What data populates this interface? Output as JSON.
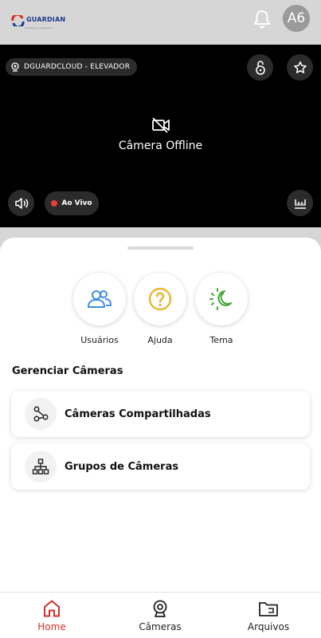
{
  "header": {
    "logo_text": "GUARDIAN",
    "logo_subtitle": "Tecnologia em Segurança",
    "avatar_initials": "A6",
    "brand_red": "#d62b25",
    "brand_blue": "#1d3a8a"
  },
  "player": {
    "camera_name": "DGUARDCLOUD - ELEVADOR",
    "status_text": "Câmera Offline",
    "live_label": "Ao Vivo",
    "live_color": "#e5403c",
    "icons": [
      "camera-icon",
      "lock-icon",
      "star-icon",
      "camera-off-icon",
      "volume-icon",
      "timeline-icon"
    ]
  },
  "quick_actions": [
    {
      "label": "Usuários",
      "icon": "users-icon",
      "color": "#3d8ee0"
    },
    {
      "label": "Ajuda",
      "icon": "help-icon",
      "color": "#e8b52d"
    },
    {
      "label": "Tema",
      "icon": "theme-icon",
      "color": "#47a53a"
    }
  ],
  "manage": {
    "title": "Gerenciar Câmeras",
    "items": [
      {
        "label": "Câmeras Compartilhadas",
        "icon": "share-icon"
      },
      {
        "label": "Grupos de Câmeras",
        "icon": "hierarchy-icon"
      }
    ]
  },
  "bottom_nav": {
    "items": [
      {
        "label": "Home",
        "icon": "home-icon",
        "active": true
      },
      {
        "label": "Câmeras",
        "icon": "webcam-icon",
        "active": false
      },
      {
        "label": "Arquivos",
        "icon": "folder-icon",
        "active": false
      }
    ],
    "active_color": "#d92c2c"
  }
}
